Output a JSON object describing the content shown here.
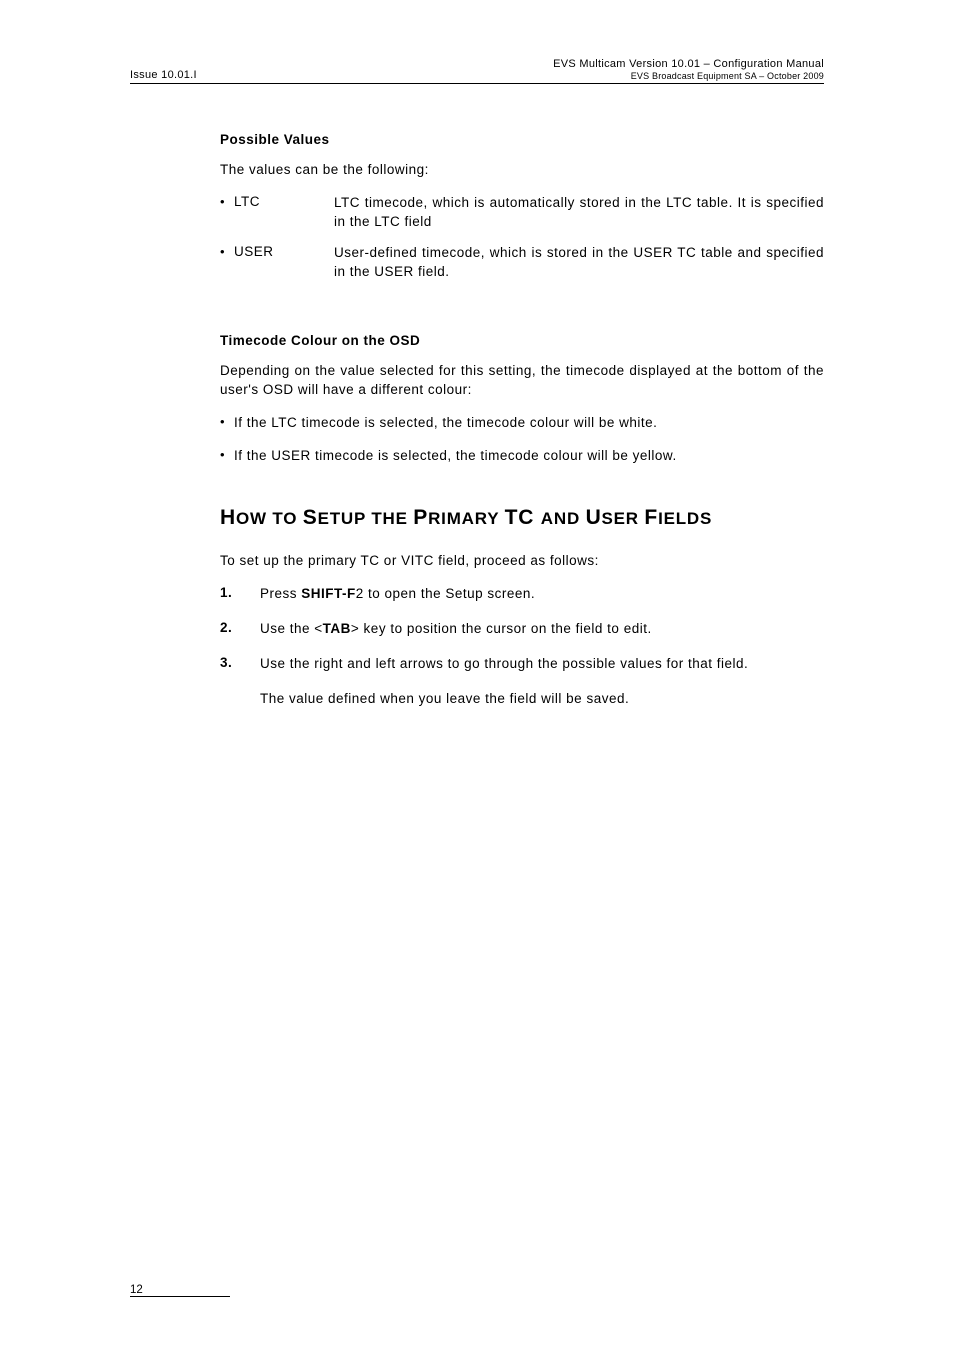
{
  "header": {
    "left": "Issue 10.01.I",
    "right_line1": "EVS Multicam Version 10.01 – Configuration Manual",
    "right_line2": "EVS Broadcast Equipment SA – October 2009"
  },
  "sections": {
    "possible_values": {
      "heading": "Possible Values",
      "intro": "The values can be the following:",
      "items": [
        {
          "term": "LTC",
          "def": "LTC timecode, which is automatically stored in the LTC table. It is specified in the LTC field"
        },
        {
          "term": "USER",
          "def": "User-defined timecode, which is stored in the USER TC table and specified in the USER field."
        }
      ]
    },
    "timecode_colour": {
      "heading": "Timecode Colour on the OSD",
      "intro": "Depending on the value selected for this setting, the timecode displayed at the bottom of the user's OSD will have a different colour:",
      "bullets": [
        "If the LTC timecode is selected, the timecode colour will be white.",
        "If the USER timecode is selected, the timecode colour will be yellow."
      ]
    },
    "how_to": {
      "heading_parts": [
        "H",
        "OW TO ",
        "S",
        "ETUP THE ",
        "P",
        "RIMARY ",
        "TC ",
        "AND ",
        "U",
        "SER ",
        "F",
        "IELDS"
      ],
      "intro": "To set up the primary TC or VITC field, proceed as follows:",
      "steps": [
        {
          "num": "1.",
          "prefix": "Press ",
          "bold": "SHIFT-F",
          "suffix": "2 to open the Setup screen."
        },
        {
          "num": "2.",
          "prefix": "Use the <",
          "bold": "TAB",
          "suffix": "> key to position the cursor on the field to edit."
        },
        {
          "num": "3.",
          "prefix": "Use the right and left arrows to go through the possible values for that field.",
          "bold": "",
          "suffix": ""
        }
      ],
      "continuation": "The value defined when you leave the field will be saved."
    }
  },
  "footer": {
    "page_number": "12"
  }
}
